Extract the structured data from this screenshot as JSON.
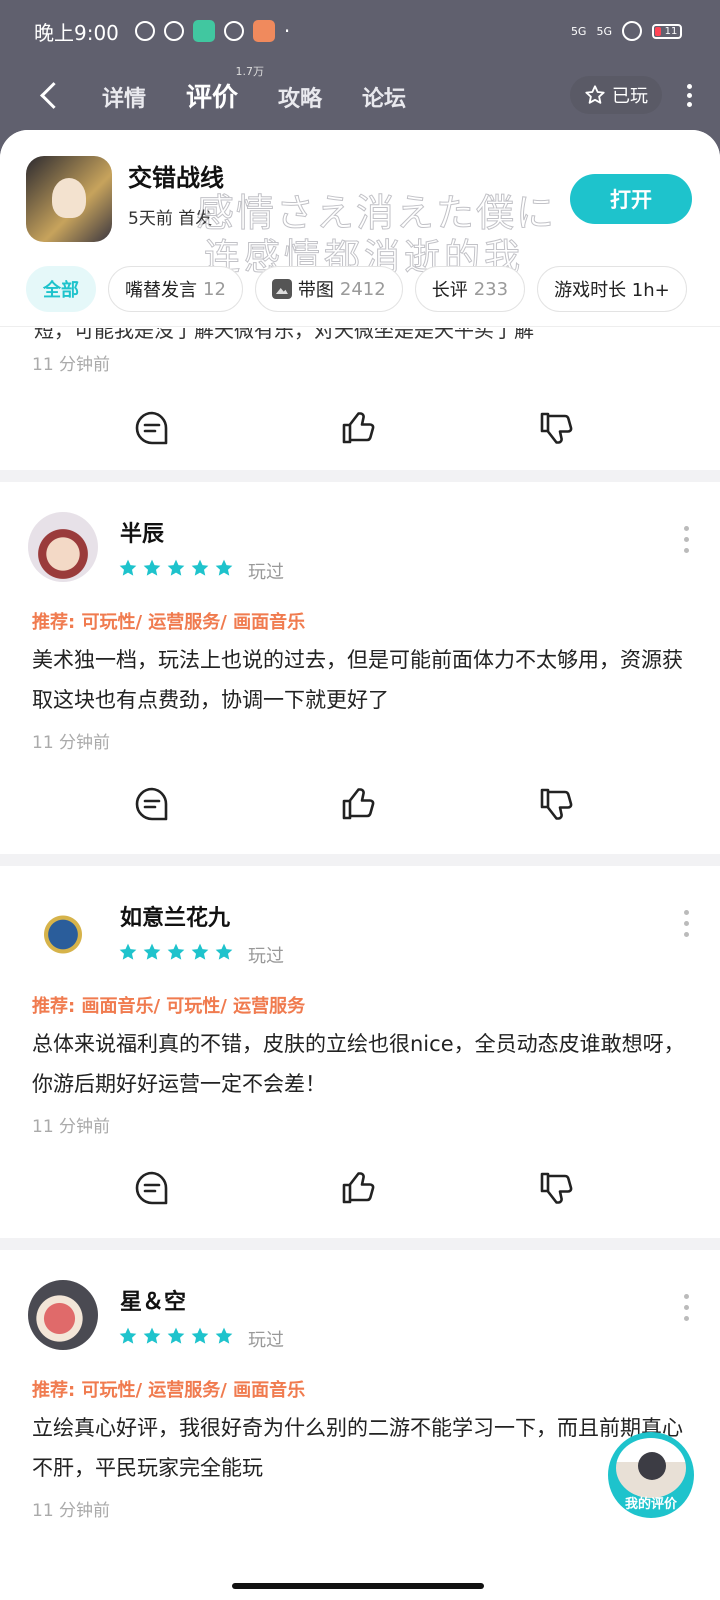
{
  "status_bar": {
    "time": "晚上9:00",
    "net1": "5G",
    "net2": "5G",
    "battery": "11"
  },
  "nav": {
    "tabs": [
      {
        "label": "详情"
      },
      {
        "label": "评价",
        "badge": "1.7万"
      },
      {
        "label": "攻略"
      },
      {
        "label": "论坛"
      }
    ],
    "played_label": "已玩"
  },
  "game": {
    "name": "交错战线",
    "subtitle": "5天前 首发",
    "open_label": "打开",
    "watermark_line1": "感情さえ消えた僕に",
    "watermark_line2": "连感情都消逝的我"
  },
  "filters": [
    {
      "label": "全部",
      "count": ""
    },
    {
      "label": "嘴替发言",
      "count": "12"
    },
    {
      "label": "带图",
      "count": "2412"
    },
    {
      "label": "长评",
      "count": "233"
    },
    {
      "label": "游戏时长 1h+",
      "count": ""
    }
  ],
  "partial_review": {
    "text_fragment": "短，可能我是没了解天微有乐，对天微坐是是天平买了解",
    "time": "11 分钟前"
  },
  "reviews": [
    {
      "user": "半辰",
      "rating": 5,
      "status": "玩过",
      "recommend": "推荐: 可玩性/ 运营服务/ 画面音乐",
      "body": "美术独一档，玩法上也说的过去，但是可能前面体力不太够用，资源获取这块也有点费劲，协调一下就更好了",
      "time": "11 分钟前"
    },
    {
      "user": "如意兰花九",
      "rating": 5,
      "status": "玩过",
      "recommend": "推荐: 画面音乐/ 可玩性/ 运营服务",
      "body": "总体来说福利真的不错，皮肤的立绘也很nice，全员动态皮谁敢想呀，你游后期好好运营一定不会差！",
      "time": "11 分钟前"
    },
    {
      "user": "星＆空",
      "rating": 5,
      "status": "玩过",
      "recommend": "推荐: 可玩性/ 运营服务/ 画面音乐",
      "body": "立绘真心好评，我很好奇为什么别的二游不能学习一下，而且前期真心不肝，平民玩家完全能玩",
      "time": "11 分钟前"
    }
  ],
  "float_button": {
    "label": "我的评价"
  },
  "colors": {
    "accent": "#1ec3cc",
    "recommend": "#f07b4f",
    "header_bg": "#60606e"
  }
}
